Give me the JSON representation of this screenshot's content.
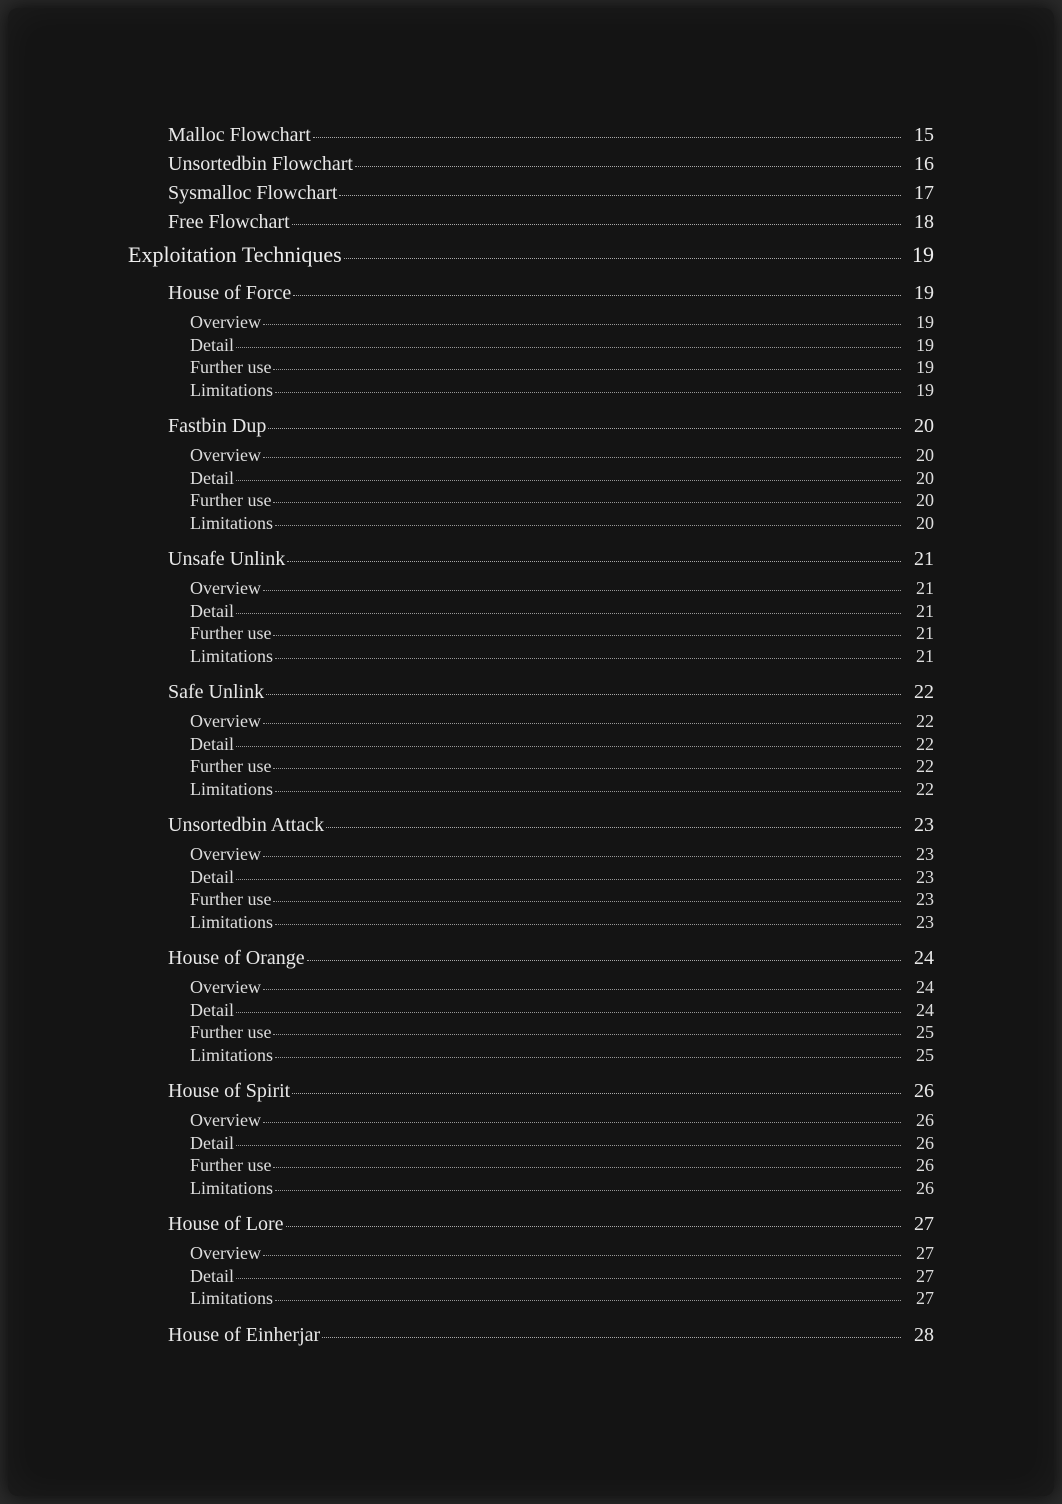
{
  "toc": [
    {
      "level": 2,
      "title": "Malloc Flowchart",
      "page": 15,
      "group_start": false
    },
    {
      "level": 2,
      "title": "Unsortedbin Flowchart",
      "page": 16,
      "group_start": false
    },
    {
      "level": 2,
      "title": "Sysmalloc Flowchart",
      "page": 17,
      "group_start": false
    },
    {
      "level": 2,
      "title": "Free Flowchart",
      "page": 18,
      "group_start": false
    },
    {
      "level": 1,
      "title": "Exploitation Techniques",
      "page": 19,
      "group_start": false
    },
    {
      "level": 2,
      "title": "House of Force",
      "page": 19,
      "group_start": true
    },
    {
      "level": 3,
      "title": "Overview",
      "page": 19
    },
    {
      "level": 3,
      "title": "Detail",
      "page": 19
    },
    {
      "level": 3,
      "title": "Further use",
      "page": 19
    },
    {
      "level": 3,
      "title": "Limitations",
      "page": 19,
      "group_end": true
    },
    {
      "level": 2,
      "title": "Fastbin Dup",
      "page": 20,
      "group_start": true
    },
    {
      "level": 3,
      "title": "Overview",
      "page": 20
    },
    {
      "level": 3,
      "title": "Detail",
      "page": 20
    },
    {
      "level": 3,
      "title": "Further use",
      "page": 20
    },
    {
      "level": 3,
      "title": "Limitations",
      "page": 20,
      "group_end": true
    },
    {
      "level": 2,
      "title": "Unsafe Unlink",
      "page": 21,
      "group_start": true
    },
    {
      "level": 3,
      "title": "Overview",
      "page": 21
    },
    {
      "level": 3,
      "title": "Detail",
      "page": 21
    },
    {
      "level": 3,
      "title": "Further use",
      "page": 21
    },
    {
      "level": 3,
      "title": "Limitations",
      "page": 21,
      "group_end": true
    },
    {
      "level": 2,
      "title": "Safe Unlink",
      "page": 22,
      "group_start": true
    },
    {
      "level": 3,
      "title": "Overview",
      "page": 22
    },
    {
      "level": 3,
      "title": "Detail",
      "page": 22
    },
    {
      "level": 3,
      "title": "Further use",
      "page": 22
    },
    {
      "level": 3,
      "title": "Limitations",
      "page": 22,
      "group_end": true
    },
    {
      "level": 2,
      "title": "Unsortedbin Attack",
      "page": 23,
      "group_start": true
    },
    {
      "level": 3,
      "title": "Overview",
      "page": 23
    },
    {
      "level": 3,
      "title": "Detail",
      "page": 23
    },
    {
      "level": 3,
      "title": "Further use",
      "page": 23
    },
    {
      "level": 3,
      "title": "Limitations",
      "page": 23,
      "group_end": true
    },
    {
      "level": 2,
      "title": "House of Orange",
      "page": 24,
      "group_start": true
    },
    {
      "level": 3,
      "title": "Overview",
      "page": 24
    },
    {
      "level": 3,
      "title": "Detail",
      "page": 24
    },
    {
      "level": 3,
      "title": "Further use",
      "page": 25
    },
    {
      "level": 3,
      "title": "Limitations",
      "page": 25,
      "group_end": true
    },
    {
      "level": 2,
      "title": "House of Spirit",
      "page": 26,
      "group_start": true
    },
    {
      "level": 3,
      "title": "Overview",
      "page": 26
    },
    {
      "level": 3,
      "title": "Detail",
      "page": 26
    },
    {
      "level": 3,
      "title": "Further use",
      "page": 26
    },
    {
      "level": 3,
      "title": "Limitations",
      "page": 26,
      "group_end": true
    },
    {
      "level": 2,
      "title": "House of Lore",
      "page": 27,
      "group_start": true
    },
    {
      "level": 3,
      "title": "Overview",
      "page": 27
    },
    {
      "level": 3,
      "title": "Detail",
      "page": 27
    },
    {
      "level": 3,
      "title": "Limitations",
      "page": 27,
      "group_end": true
    },
    {
      "level": 2,
      "title": "House of Einherjar",
      "page": 28,
      "group_start": true
    }
  ]
}
